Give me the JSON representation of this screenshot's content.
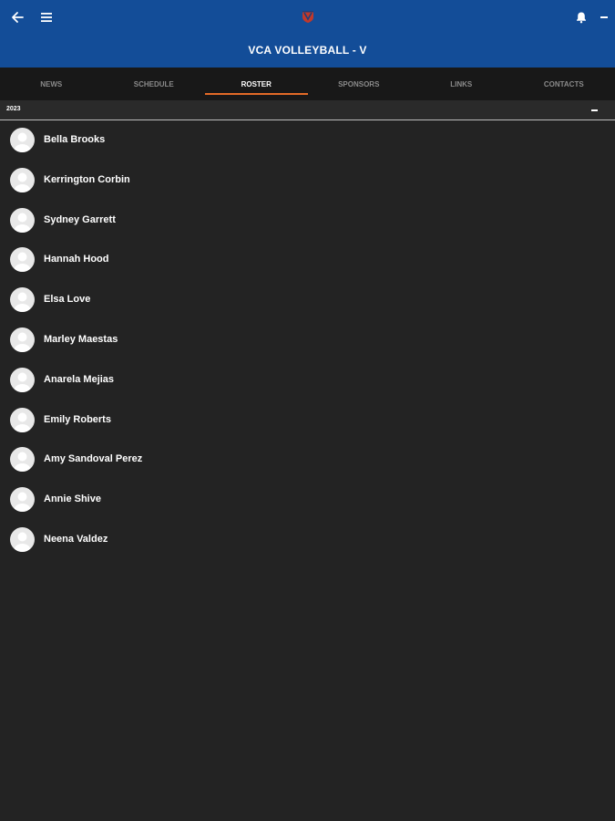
{
  "header": {
    "title": "VCA VOLLEYBALL - V",
    "icons": {
      "back": "arrow-left-icon",
      "menu": "hamburger-menu-icon",
      "logo": "team-logo-icon",
      "notifications": "bell-icon",
      "more": "more-icon"
    },
    "brand_color": "#134d98"
  },
  "tabs": [
    {
      "label": "NEWS",
      "active": false
    },
    {
      "label": "SCHEDULE",
      "active": false
    },
    {
      "label": "ROSTER",
      "active": true
    },
    {
      "label": "SPONSORS",
      "active": false
    },
    {
      "label": "LINKS",
      "active": false
    },
    {
      "label": "CONTACTS",
      "active": false
    }
  ],
  "accent_color": "#e36a27",
  "roster": {
    "section_label": "2023",
    "collapse_icon": "minus-icon",
    "players": [
      {
        "name": "Bella Brooks"
      },
      {
        "name": "Kerrington Corbin"
      },
      {
        "name": "Sydney Garrett"
      },
      {
        "name": "Hannah Hood"
      },
      {
        "name": "Elsa Love"
      },
      {
        "name": "Marley Maestas"
      },
      {
        "name": "Anarela Mejias"
      },
      {
        "name": "Emily Roberts"
      },
      {
        "name": "Amy Sandoval Perez"
      },
      {
        "name": "Annie Shive"
      },
      {
        "name": "Neena Valdez"
      }
    ]
  }
}
